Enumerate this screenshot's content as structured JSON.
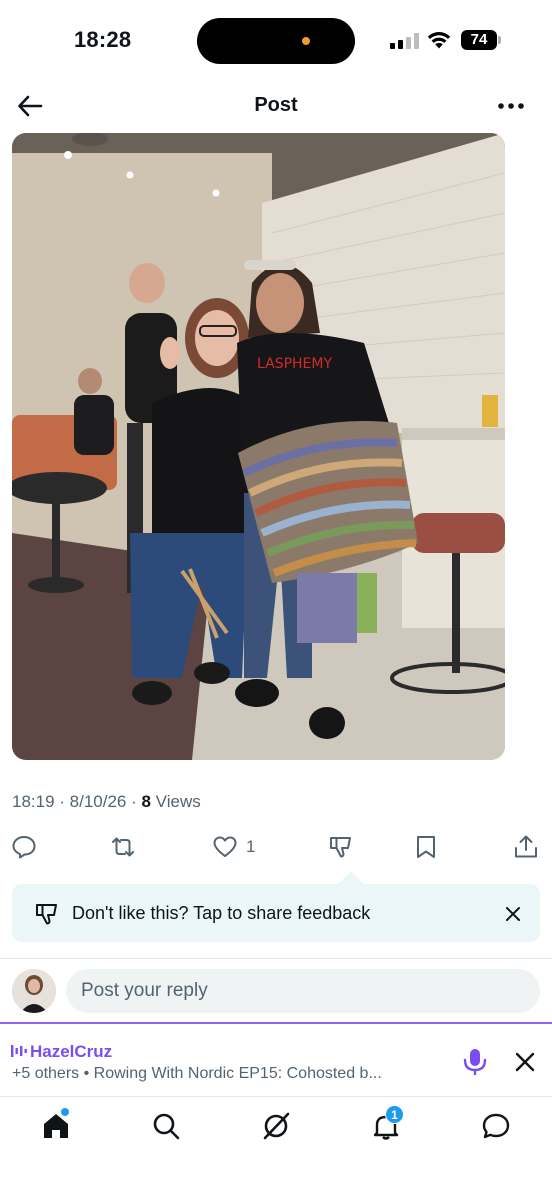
{
  "status_bar": {
    "time": "18:28",
    "battery": "74"
  },
  "header": {
    "title": "Post"
  },
  "post": {
    "timestamp": "18:19 · 8/10/26",
    "separator": " · ",
    "views_count": "8",
    "views_label": " Views"
  },
  "actions": {
    "like_count": "1"
  },
  "feedback": {
    "text": "Don't like this? Tap to share feedback"
  },
  "reply": {
    "placeholder": "Post your reply"
  },
  "spaces": {
    "host": "HazelCruz",
    "subtitle": "+5 others • Rowing With Nordic EP15: Cohosted b..."
  },
  "bottom_nav": {
    "notification_badge": "1"
  },
  "colors": {
    "accent_blue": "#1d9bf0",
    "spaces_purple": "#7b4df0",
    "banner_bg": "#eaf6f8"
  },
  "icons": [
    "back-arrow-icon",
    "more-icon",
    "reply-icon",
    "repost-icon",
    "heart-icon",
    "dislike-icon",
    "bookmark-icon",
    "share-icon",
    "close-icon",
    "mic-icon",
    "home-icon",
    "search-icon",
    "grok-icon",
    "bell-icon",
    "messages-icon"
  ]
}
